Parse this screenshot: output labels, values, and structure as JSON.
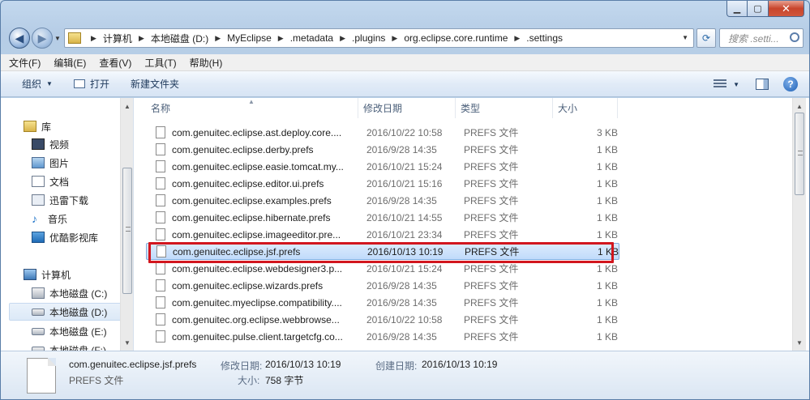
{
  "address": {
    "crumbs": [
      "计算机",
      "本地磁盘 (D:)",
      "MyEclipse",
      ".metadata",
      ".plugins",
      "org.eclipse.core.runtime",
      ".settings"
    ]
  },
  "search": {
    "placeholder": "搜索 .setti..."
  },
  "menu": [
    "文件(F)",
    "编辑(E)",
    "查看(V)",
    "工具(T)",
    "帮助(H)"
  ],
  "commands": {
    "organize": "组织",
    "open": "打开",
    "new_folder": "新建文件夹"
  },
  "nav": {
    "library": "库",
    "items": [
      "视频",
      "图片",
      "文档",
      "迅雷下载",
      "音乐",
      "优酷影视库"
    ],
    "computer": "计算机",
    "drives": [
      "本地磁盘 (C:)",
      "本地磁盘 (D:)",
      "本地磁盘 (E:)",
      "本地磁盘 (F:)"
    ]
  },
  "columns": {
    "name": "名称",
    "date": "修改日期",
    "type": "类型",
    "size": "大小"
  },
  "files": [
    {
      "name": "com.genuitec.eclipse.ast.deploy.core....",
      "date": "2016/10/22 10:58",
      "type": "PREFS 文件",
      "size": "3 KB"
    },
    {
      "name": "com.genuitec.eclipse.derby.prefs",
      "date": "2016/9/28 14:35",
      "type": "PREFS 文件",
      "size": "1 KB"
    },
    {
      "name": "com.genuitec.eclipse.easie.tomcat.my...",
      "date": "2016/10/21 15:24",
      "type": "PREFS 文件",
      "size": "1 KB"
    },
    {
      "name": "com.genuitec.eclipse.editor.ui.prefs",
      "date": "2016/10/21 15:16",
      "type": "PREFS 文件",
      "size": "1 KB"
    },
    {
      "name": "com.genuitec.eclipse.examples.prefs",
      "date": "2016/9/28 14:35",
      "type": "PREFS 文件",
      "size": "1 KB"
    },
    {
      "name": "com.genuitec.eclipse.hibernate.prefs",
      "date": "2016/10/21 14:55",
      "type": "PREFS 文件",
      "size": "1 KB"
    },
    {
      "name": "com.genuitec.eclipse.imageeditor.pre...",
      "date": "2016/10/21 23:34",
      "type": "PREFS 文件",
      "size": "1 KB"
    },
    {
      "name": "com.genuitec.eclipse.jsf.prefs",
      "date": "2016/10/13 10:19",
      "type": "PREFS 文件",
      "size": "1 KB"
    },
    {
      "name": "com.genuitec.eclipse.webdesigner3.p...",
      "date": "2016/10/21 15:24",
      "type": "PREFS 文件",
      "size": "1 KB"
    },
    {
      "name": "com.genuitec.eclipse.wizards.prefs",
      "date": "2016/9/28 14:35",
      "type": "PREFS 文件",
      "size": "1 KB"
    },
    {
      "name": "com.genuitec.myeclipse.compatibility....",
      "date": "2016/9/28 14:35",
      "type": "PREFS 文件",
      "size": "1 KB"
    },
    {
      "name": "com.genuitec.org.eclipse.webbrowse...",
      "date": "2016/10/22 10:58",
      "type": "PREFS 文件",
      "size": "1 KB"
    },
    {
      "name": "com.genuitec.pulse.client.targetcfg.co...",
      "date": "2016/9/28 14:35",
      "type": "PREFS 文件",
      "size": "1 KB"
    }
  ],
  "selected_index": 7,
  "details": {
    "name": "com.genuitec.eclipse.jsf.prefs",
    "type": "PREFS 文件",
    "modified_label": "修改日期:",
    "modified_value": "2016/10/13 10:19",
    "created_label": "创建日期:",
    "created_value": "2016/10/13 10:19",
    "size_label": "大小:",
    "size_value": "758 字节"
  },
  "colors": {
    "highlight": "#d2161e",
    "selection": "#c1dbfb"
  }
}
